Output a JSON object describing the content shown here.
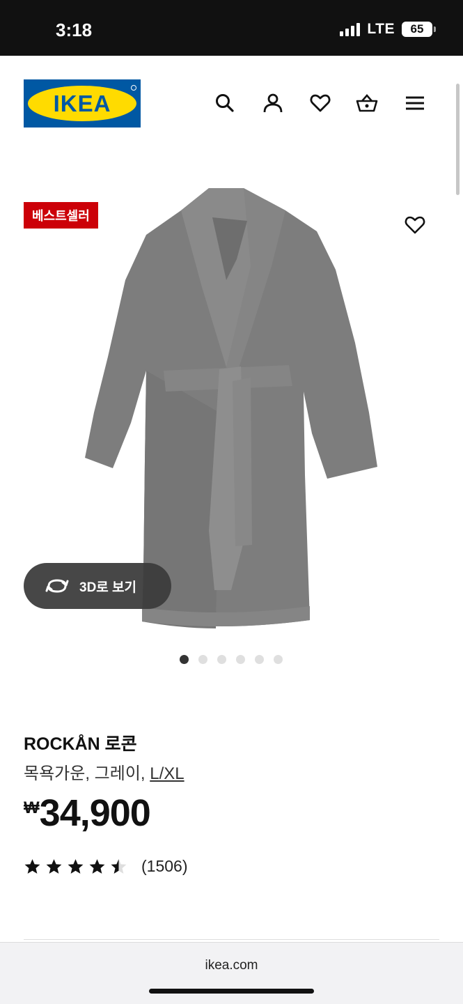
{
  "status_bar": {
    "time": "3:18",
    "network": "LTE",
    "battery": "65"
  },
  "header": {
    "logo_text": "IKEA",
    "icons": [
      "search-icon",
      "user-icon",
      "heart-icon",
      "basket-icon",
      "menu-icon"
    ]
  },
  "product": {
    "badge": "베스트셀러",
    "view_3d_label": "3D로 보기",
    "image_count": 6,
    "active_image": 0,
    "name": "ROCKÅN 로콘",
    "description": "목욕가운, 그레이, ",
    "size": "L/XL",
    "currency": "₩",
    "price": "34,900",
    "rating": 4.5,
    "review_count": "(1506)"
  },
  "browser": {
    "url": "ikea.com"
  },
  "colors": {
    "ikea_blue": "#0058a3",
    "ikea_yellow": "#ffdb00",
    "badge_red": "#cc0008"
  }
}
